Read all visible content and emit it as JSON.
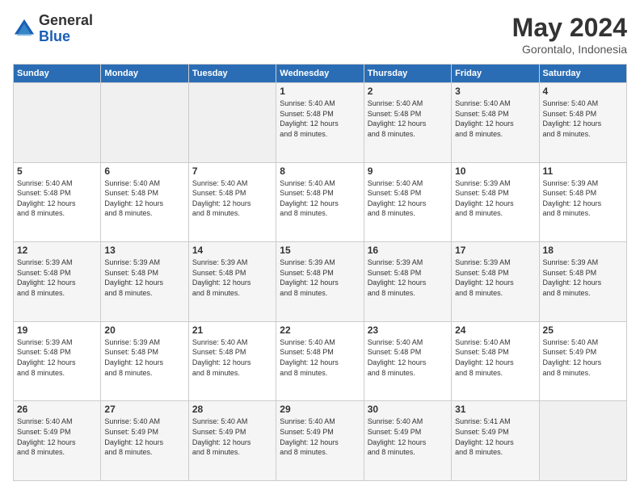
{
  "header": {
    "logo_general": "General",
    "logo_blue": "Blue",
    "month_title": "May 2024",
    "subtitle": "Gorontalo, Indonesia"
  },
  "days_of_week": [
    "Sunday",
    "Monday",
    "Tuesday",
    "Wednesday",
    "Thursday",
    "Friday",
    "Saturday"
  ],
  "weeks": [
    [
      {
        "day": "",
        "info": ""
      },
      {
        "day": "",
        "info": ""
      },
      {
        "day": "",
        "info": ""
      },
      {
        "day": "1",
        "info": "Sunrise: 5:40 AM\nSunset: 5:48 PM\nDaylight: 12 hours\nand 8 minutes."
      },
      {
        "day": "2",
        "info": "Sunrise: 5:40 AM\nSunset: 5:48 PM\nDaylight: 12 hours\nand 8 minutes."
      },
      {
        "day": "3",
        "info": "Sunrise: 5:40 AM\nSunset: 5:48 PM\nDaylight: 12 hours\nand 8 minutes."
      },
      {
        "day": "4",
        "info": "Sunrise: 5:40 AM\nSunset: 5:48 PM\nDaylight: 12 hours\nand 8 minutes."
      }
    ],
    [
      {
        "day": "5",
        "info": "Sunrise: 5:40 AM\nSunset: 5:48 PM\nDaylight: 12 hours\nand 8 minutes."
      },
      {
        "day": "6",
        "info": "Sunrise: 5:40 AM\nSunset: 5:48 PM\nDaylight: 12 hours\nand 8 minutes."
      },
      {
        "day": "7",
        "info": "Sunrise: 5:40 AM\nSunset: 5:48 PM\nDaylight: 12 hours\nand 8 minutes."
      },
      {
        "day": "8",
        "info": "Sunrise: 5:40 AM\nSunset: 5:48 PM\nDaylight: 12 hours\nand 8 minutes."
      },
      {
        "day": "9",
        "info": "Sunrise: 5:40 AM\nSunset: 5:48 PM\nDaylight: 12 hours\nand 8 minutes."
      },
      {
        "day": "10",
        "info": "Sunrise: 5:39 AM\nSunset: 5:48 PM\nDaylight: 12 hours\nand 8 minutes."
      },
      {
        "day": "11",
        "info": "Sunrise: 5:39 AM\nSunset: 5:48 PM\nDaylight: 12 hours\nand 8 minutes."
      }
    ],
    [
      {
        "day": "12",
        "info": "Sunrise: 5:39 AM\nSunset: 5:48 PM\nDaylight: 12 hours\nand 8 minutes."
      },
      {
        "day": "13",
        "info": "Sunrise: 5:39 AM\nSunset: 5:48 PM\nDaylight: 12 hours\nand 8 minutes."
      },
      {
        "day": "14",
        "info": "Sunrise: 5:39 AM\nSunset: 5:48 PM\nDaylight: 12 hours\nand 8 minutes."
      },
      {
        "day": "15",
        "info": "Sunrise: 5:39 AM\nSunset: 5:48 PM\nDaylight: 12 hours\nand 8 minutes."
      },
      {
        "day": "16",
        "info": "Sunrise: 5:39 AM\nSunset: 5:48 PM\nDaylight: 12 hours\nand 8 minutes."
      },
      {
        "day": "17",
        "info": "Sunrise: 5:39 AM\nSunset: 5:48 PM\nDaylight: 12 hours\nand 8 minutes."
      },
      {
        "day": "18",
        "info": "Sunrise: 5:39 AM\nSunset: 5:48 PM\nDaylight: 12 hours\nand 8 minutes."
      }
    ],
    [
      {
        "day": "19",
        "info": "Sunrise: 5:39 AM\nSunset: 5:48 PM\nDaylight: 12 hours\nand 8 minutes."
      },
      {
        "day": "20",
        "info": "Sunrise: 5:39 AM\nSunset: 5:48 PM\nDaylight: 12 hours\nand 8 minutes."
      },
      {
        "day": "21",
        "info": "Sunrise: 5:40 AM\nSunset: 5:48 PM\nDaylight: 12 hours\nand 8 minutes."
      },
      {
        "day": "22",
        "info": "Sunrise: 5:40 AM\nSunset: 5:48 PM\nDaylight: 12 hours\nand 8 minutes."
      },
      {
        "day": "23",
        "info": "Sunrise: 5:40 AM\nSunset: 5:48 PM\nDaylight: 12 hours\nand 8 minutes."
      },
      {
        "day": "24",
        "info": "Sunrise: 5:40 AM\nSunset: 5:48 PM\nDaylight: 12 hours\nand 8 minutes."
      },
      {
        "day": "25",
        "info": "Sunrise: 5:40 AM\nSunset: 5:49 PM\nDaylight: 12 hours\nand 8 minutes."
      }
    ],
    [
      {
        "day": "26",
        "info": "Sunrise: 5:40 AM\nSunset: 5:49 PM\nDaylight: 12 hours\nand 8 minutes."
      },
      {
        "day": "27",
        "info": "Sunrise: 5:40 AM\nSunset: 5:49 PM\nDaylight: 12 hours\nand 8 minutes."
      },
      {
        "day": "28",
        "info": "Sunrise: 5:40 AM\nSunset: 5:49 PM\nDaylight: 12 hours\nand 8 minutes."
      },
      {
        "day": "29",
        "info": "Sunrise: 5:40 AM\nSunset: 5:49 PM\nDaylight: 12 hours\nand 8 minutes."
      },
      {
        "day": "30",
        "info": "Sunrise: 5:40 AM\nSunset: 5:49 PM\nDaylight: 12 hours\nand 8 minutes."
      },
      {
        "day": "31",
        "info": "Sunrise: 5:41 AM\nSunset: 5:49 PM\nDaylight: 12 hours\nand 8 minutes."
      },
      {
        "day": "",
        "info": ""
      }
    ]
  ]
}
